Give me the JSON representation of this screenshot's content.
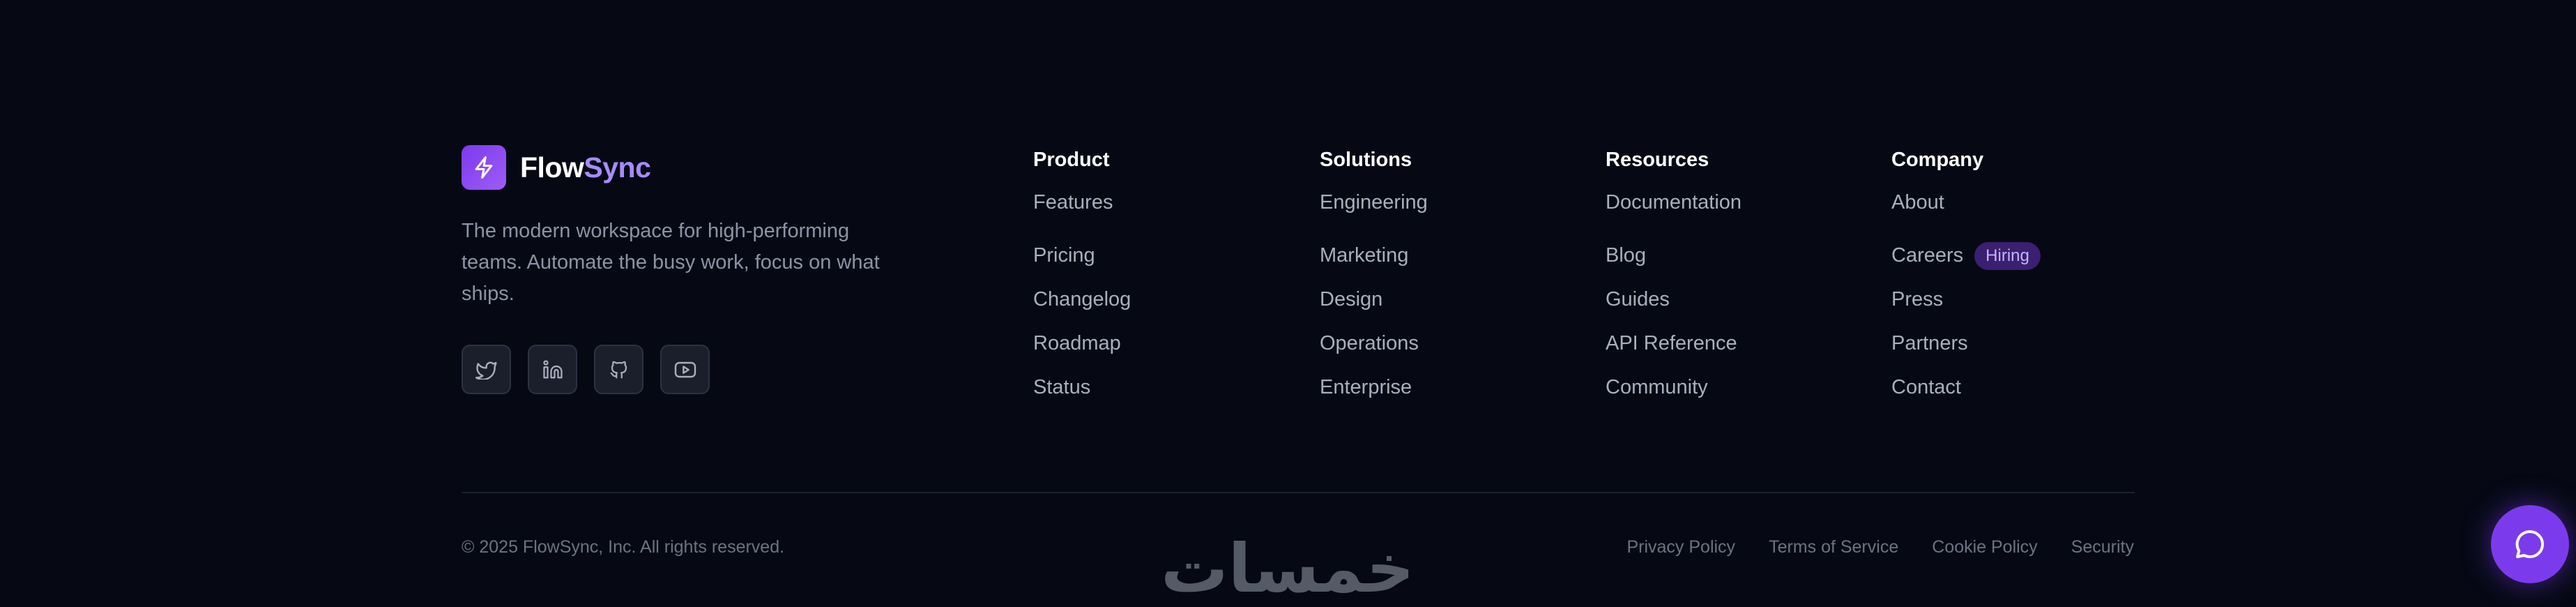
{
  "brand": {
    "name_part1": "Flow",
    "name_part2": "Sync",
    "tagline": "The modern workspace for high-performing teams. Automate the busy work, focus on what ships.",
    "icon": "lightning-bolt-icon",
    "accent_color": "#7c3aed"
  },
  "socials": [
    {
      "icon": "twitter-icon"
    },
    {
      "icon": "linkedin-icon"
    },
    {
      "icon": "github-icon"
    },
    {
      "icon": "youtube-icon"
    }
  ],
  "columns": [
    {
      "title": "Product",
      "links": [
        "Features",
        "Pricing",
        "Changelog",
        "Roadmap",
        "Status"
      ]
    },
    {
      "title": "Solutions",
      "links": [
        "Engineering",
        "Marketing",
        "Design",
        "Operations",
        "Enterprise"
      ]
    },
    {
      "title": "Resources",
      "links": [
        "Documentation",
        "Blog",
        "Guides",
        "API Reference",
        "Community"
      ]
    },
    {
      "title": "Company",
      "links": [
        "About",
        "Careers",
        "Press",
        "Partners",
        "Contact"
      ],
      "badge": "Hiring"
    }
  ],
  "bottom": {
    "copyright": "© 2025 FlowSync, Inc. All rights reserved.",
    "legal_links": [
      "Privacy Policy",
      "Terms of Service",
      "Cookie Policy",
      "Security"
    ]
  },
  "watermark": "خمسات",
  "chat": {
    "icon": "chat-bubble-icon"
  }
}
